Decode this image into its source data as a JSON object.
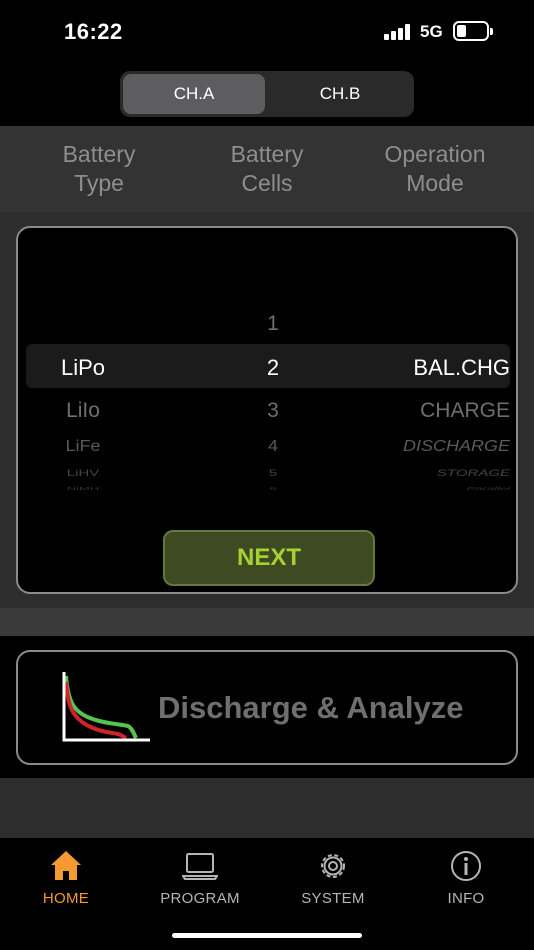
{
  "status": {
    "time": "16:22",
    "network": "5G"
  },
  "channels": {
    "a": "CH.A",
    "b": "CH.B",
    "selected": "CH.A"
  },
  "headers": {
    "battery_type": [
      "Battery",
      "Type"
    ],
    "battery_cells": [
      "Battery",
      "Cells"
    ],
    "operation_mode": [
      "Operation",
      "Mode"
    ]
  },
  "picker": {
    "battery_types": {
      "selected": "LiPo",
      "items": [
        "LiPo",
        "LiIo",
        "LiFe",
        "LiHV",
        "NiMH"
      ]
    },
    "cells": {
      "above": "1",
      "selected": "2",
      "items": [
        "3",
        "4",
        "5",
        "6"
      ]
    },
    "modes": {
      "selected": "BAL.CHG",
      "items": [
        "CHARGE",
        "DISCHARGE",
        "STORAGE",
        "Parallel"
      ]
    }
  },
  "next_label": "NEXT",
  "discharge_label": "Discharge & Analyze",
  "tabs": [
    {
      "label": "HOME",
      "icon": "home-icon",
      "active": true
    },
    {
      "label": "PROGRAM",
      "icon": "laptop-icon",
      "active": false
    },
    {
      "label": "SYSTEM",
      "icon": "gear-icon",
      "active": false
    },
    {
      "label": "INFO",
      "icon": "info-icon",
      "active": false
    }
  ],
  "colors": {
    "accent": "#f39a31",
    "next_text": "#a6d133",
    "curve_green": "#56c44f",
    "curve_red": "#d0242a"
  }
}
